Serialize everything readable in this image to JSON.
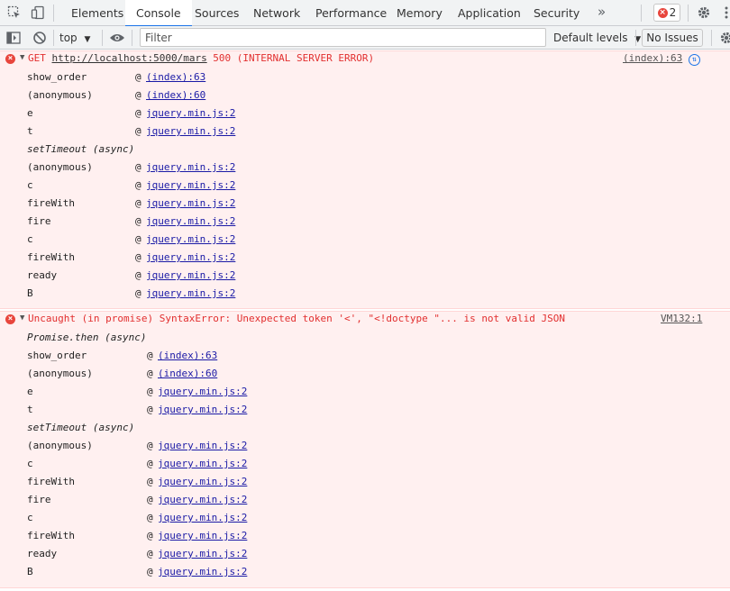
{
  "tabs": {
    "items": [
      {
        "label": "Elements"
      },
      {
        "label": "Console"
      },
      {
        "label": "Sources"
      },
      {
        "label": "Network"
      },
      {
        "label": "Performance"
      },
      {
        "label": "Memory"
      },
      {
        "label": "Application"
      },
      {
        "label": "Security"
      }
    ],
    "active": "Console",
    "more": "»",
    "error_count": "2"
  },
  "toolbar": {
    "context": "top",
    "filter_placeholder": "Filter",
    "levels": "Default levels",
    "no_issues": "No Issues"
  },
  "messages": [
    {
      "text_prefix": "GET ",
      "url": "http://localhost:5000/mars",
      "text_suffix": " 500 (INTERNAL SERVER ERROR)",
      "source": "(index):63",
      "stack": [
        {
          "fn": "show_order",
          "link": "(index):63"
        },
        {
          "fn": "(anonymous)",
          "link": "(index):60"
        },
        {
          "fn": "e",
          "link": "jquery.min.js:2"
        },
        {
          "fn": "t",
          "link": "jquery.min.js:2"
        },
        {
          "async": "setTimeout (async)"
        },
        {
          "fn": "(anonymous)",
          "link": "jquery.min.js:2"
        },
        {
          "fn": "c",
          "link": "jquery.min.js:2"
        },
        {
          "fn": "fireWith",
          "link": "jquery.min.js:2"
        },
        {
          "fn": "fire",
          "link": "jquery.min.js:2"
        },
        {
          "fn": "c",
          "link": "jquery.min.js:2"
        },
        {
          "fn": "fireWith",
          "link": "jquery.min.js:2"
        },
        {
          "fn": "ready",
          "link": "jquery.min.js:2"
        },
        {
          "fn": "B",
          "link": "jquery.min.js:2"
        }
      ]
    },
    {
      "text": "Uncaught (in promise) SyntaxError: Unexpected token '<', \"<!doctype \"... is not valid JSON",
      "source": "VM132:1",
      "stack": [
        {
          "async": "Promise.then (async)"
        },
        {
          "fn": "show_order",
          "link": "(index):63"
        },
        {
          "fn": "(anonymous)",
          "link": "(index):60"
        },
        {
          "fn": "e",
          "link": "jquery.min.js:2"
        },
        {
          "fn": "t",
          "link": "jquery.min.js:2"
        },
        {
          "async": "setTimeout (async)"
        },
        {
          "fn": "(anonymous)",
          "link": "jquery.min.js:2"
        },
        {
          "fn": "c",
          "link": "jquery.min.js:2"
        },
        {
          "fn": "fireWith",
          "link": "jquery.min.js:2"
        },
        {
          "fn": "fire",
          "link": "jquery.min.js:2"
        },
        {
          "fn": "c",
          "link": "jquery.min.js:2"
        },
        {
          "fn": "fireWith",
          "link": "jquery.min.js:2"
        },
        {
          "fn": "ready",
          "link": "jquery.min.js:2"
        },
        {
          "fn": "B",
          "link": "jquery.min.js:2"
        }
      ]
    }
  ],
  "colors": {
    "error_text": "#e22f2f",
    "error_bg": "#fff0f0",
    "link": "#1a1aa6",
    "active_tab_underline": "#1a73e8"
  }
}
